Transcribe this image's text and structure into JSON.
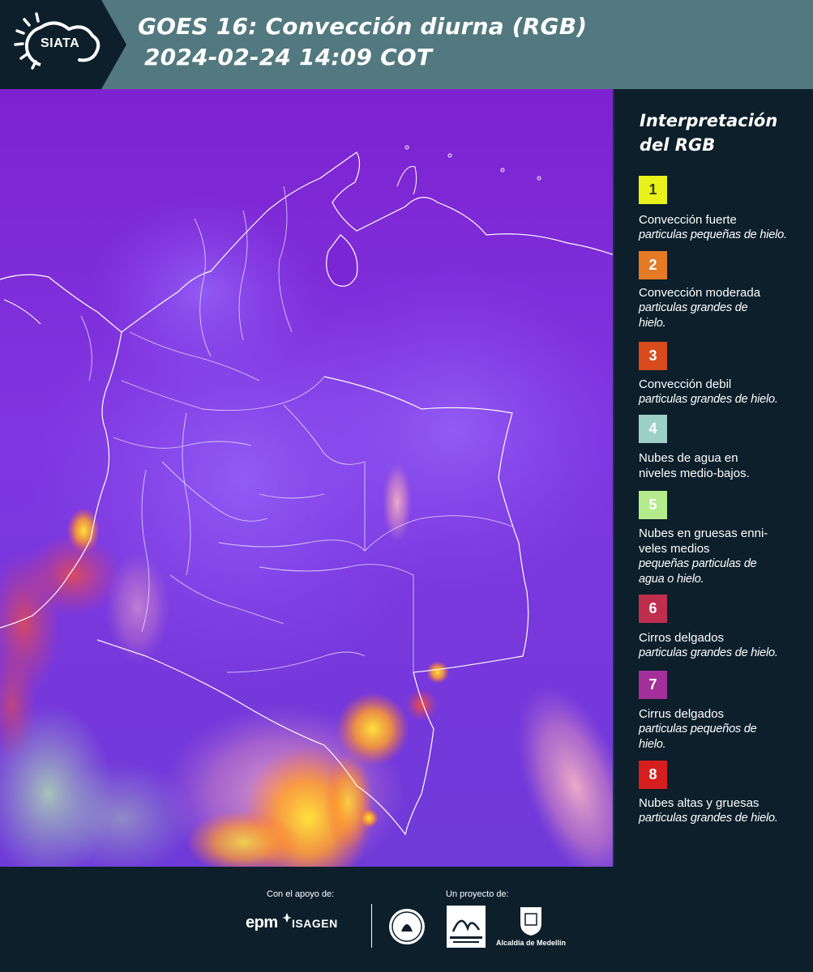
{
  "header": {
    "logo_text": "SIATA",
    "title_line1": "GOES 16: Convección diurna (RGB)",
    "title_line2": "2024-02-24 14:09 COT"
  },
  "legend": {
    "title": "Interpretación del RGB",
    "items": [
      {
        "num": "1",
        "color": "#e8f21a",
        "num_color": "#3a3a10",
        "title": "Convección fuerte",
        "subtitle": "particulas pequeñas de hielo."
      },
      {
        "num": "2",
        "color": "#e57a25",
        "num_color": "#ffffff",
        "title": "Convección moderada",
        "subtitle": "particulas grandes de hielo."
      },
      {
        "num": "3",
        "color": "#d94a1c",
        "num_color": "#ffffff",
        "title": "Convección debil",
        "subtitle": "particulas grandes de hielo."
      },
      {
        "num": "4",
        "color": "#9cd0c6",
        "num_color": "#ffffff",
        "title": "Nubes de agua en niveles medio-bajos.",
        "subtitle": ""
      },
      {
        "num": "5",
        "color": "#b4eb8c",
        "num_color": "#ffffff",
        "title": "Nubes en gruesas enni-veles medios",
        "subtitle": "pequeñas particulas de agua o hielo."
      },
      {
        "num": "6",
        "color": "#c02e4e",
        "num_color": "#ffffff",
        "title": "Cirros delgados",
        "subtitle": "particulas grandes de hielo."
      },
      {
        "num": "7",
        "color": "#a3309a",
        "num_color": "#ffffff",
        "title": "Cirrus delgados",
        "subtitle": "particulas pequeños de hielo."
      },
      {
        "num": "8",
        "color": "#d61e1e",
        "num_color": "#ffffff",
        "title": "Nubes altas y gruesas",
        "subtitle": "particulas grandes de hielo."
      }
    ]
  },
  "footer": {
    "support_label": "Con el apoyo de:",
    "project_label": "Un proyecto de:",
    "sponsor1": "epm",
    "sponsor2": "ISAGEN",
    "partner1": "Área Metropolitana Valle de Aburrá",
    "partner2": "Alcaldía de Medellín"
  }
}
